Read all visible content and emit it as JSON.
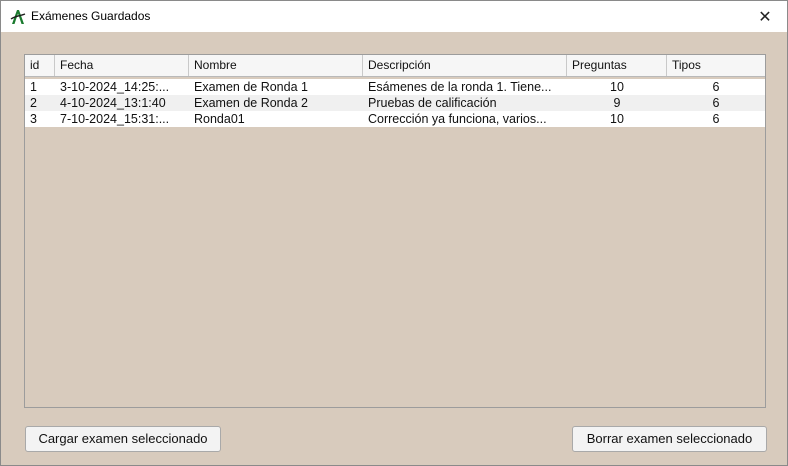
{
  "window": {
    "title": "Exámenes Guardados",
    "close_glyph": "✕",
    "icon": "app-logo-icon"
  },
  "table": {
    "columns": [
      "id",
      "Fecha",
      "Nombre",
      "Descripción",
      "Preguntas",
      "Tipos"
    ],
    "rows": [
      [
        "1",
        "3-10-2024_14:25:...",
        "Examen de Ronda 1",
        "Esámenes de la ronda 1. Tiene...",
        "10",
        "6"
      ],
      [
        "2",
        "4-10-2024_13:1:40",
        "Examen de Ronda 2",
        "Pruebas de calificación",
        "9",
        "6"
      ],
      [
        "3",
        "7-10-2024_15:31:...",
        "Ronda01",
        "Corrección ya funciona, varios...",
        "10",
        "6"
      ]
    ]
  },
  "buttons": {
    "load": "Cargar examen seleccionado",
    "delete": "Borrar examen seleccionado"
  },
  "colors": {
    "background": "#d8cbbd",
    "titlebar": "#ffffff"
  }
}
